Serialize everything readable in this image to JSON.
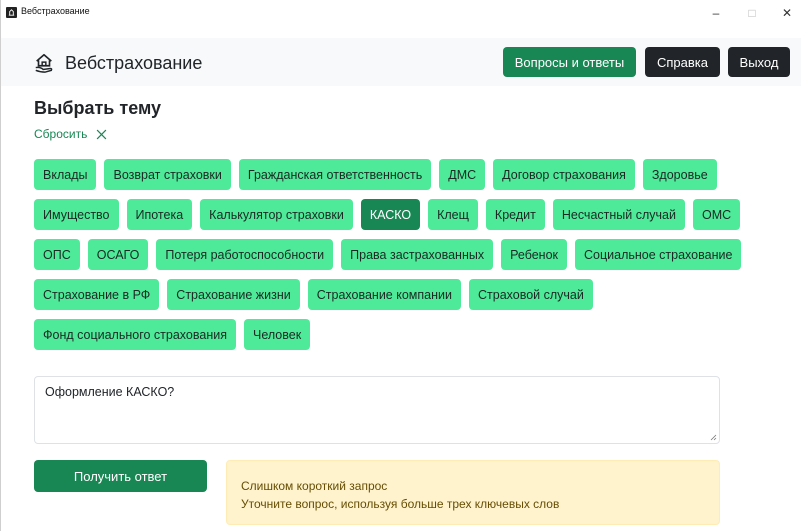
{
  "window": {
    "title": "Вебстрахование",
    "minimize": "–",
    "maximize": "□",
    "close": "✕"
  },
  "header": {
    "brand": "Вебстрахование",
    "faq_label": "Вопросы и ответы",
    "help_label": "Справка",
    "exit_label": "Выход"
  },
  "topics": {
    "title": "Выбрать тему",
    "reset_label": "Сбросить",
    "items": [
      {
        "label": "Вклады",
        "active": false
      },
      {
        "label": "Возврат страховки",
        "active": false
      },
      {
        "label": "Гражданская ответственность",
        "active": false
      },
      {
        "label": "ДМС",
        "active": false
      },
      {
        "label": "Договор страхования",
        "active": false
      },
      {
        "label": "Здоровье",
        "active": false
      },
      {
        "label": "Имущество",
        "active": false
      },
      {
        "label": "Ипотека",
        "active": false
      },
      {
        "label": "Калькулятор страховки",
        "active": false
      },
      {
        "label": "КАСКО",
        "active": true
      },
      {
        "label": "Клещ",
        "active": false
      },
      {
        "label": "Кредит",
        "active": false
      },
      {
        "label": "Несчастный случай",
        "active": false
      },
      {
        "label": "ОМС",
        "active": false
      },
      {
        "label": "ОПС",
        "active": false
      },
      {
        "label": "ОСАГО",
        "active": false
      },
      {
        "label": "Потеря работоспособности",
        "active": false
      },
      {
        "label": "Права застрахованных",
        "active": false
      },
      {
        "label": "Ребенок",
        "active": false
      },
      {
        "label": "Социальное страхование",
        "active": false
      },
      {
        "label": "Страхование в РФ",
        "active": false
      },
      {
        "label": "Страхование жизни",
        "active": false
      },
      {
        "label": "Страхование компании",
        "active": false
      },
      {
        "label": "Страховой случай",
        "active": false
      },
      {
        "label": "Фонд социального страхования",
        "active": false
      },
      {
        "label": "Человек",
        "active": false
      }
    ]
  },
  "query": {
    "value": "Оформление КАСКО?"
  },
  "submit_label": "Получить ответ",
  "alert": {
    "line1": "Слишком короткий запрос",
    "line2": "Уточните вопрос, используя больше трех ключевых слов"
  },
  "colors": {
    "primary": "#198754",
    "tag": "#4eea9a",
    "dark": "#212529",
    "warning_bg": "#fff3cd"
  }
}
